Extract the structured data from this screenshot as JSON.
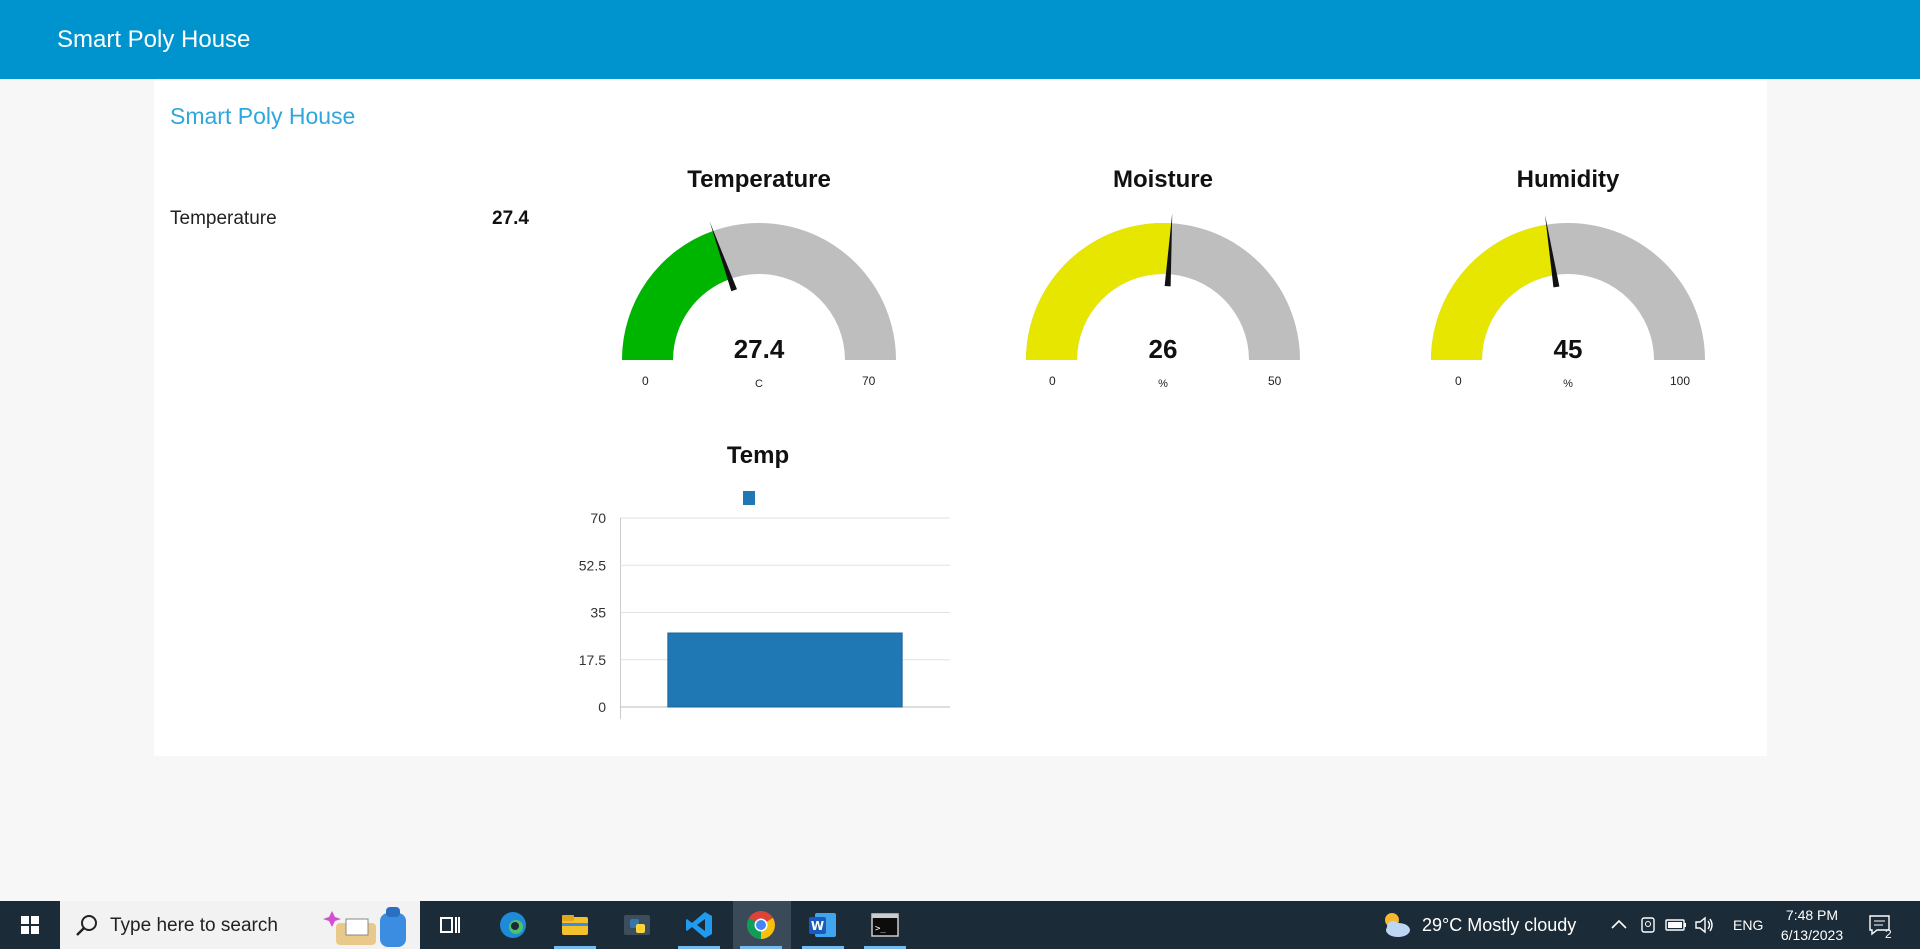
{
  "app": {
    "title": "Smart Poly House"
  },
  "card": {
    "title": "Smart Poly House"
  },
  "text_widget": {
    "label": "Temperature",
    "value": "27.4"
  },
  "gauges": [
    {
      "title": "Temperature",
      "value": "27.4",
      "unit": "C",
      "min": "0",
      "max": "70",
      "fraction": 0.391,
      "fill_color": "#00b500",
      "track_color": "#bebebe"
    },
    {
      "title": "Moisture",
      "value": "26",
      "unit": "%",
      "min": "0",
      "max": "50",
      "fraction": 0.52,
      "fill_color": "#e6e600",
      "track_color": "#bebebe"
    },
    {
      "title": "Humidity",
      "value": "45",
      "unit": "%",
      "min": "0",
      "max": "100",
      "fraction": 0.45,
      "fill_color": "#e6e600",
      "track_color": "#bebebe"
    }
  ],
  "chart_title": "Temp",
  "chart_data": {
    "type": "bar",
    "categories": [
      ""
    ],
    "values": [
      27.4
    ],
    "ylim": [
      0,
      70
    ],
    "yticks": [
      "0",
      "17.5",
      "35",
      "52.5",
      "70"
    ],
    "ytick_values": [
      0,
      17.5,
      35,
      52.5,
      70
    ],
    "grid": true,
    "legend": "top-center",
    "bar_color": "#1f77b4"
  },
  "taskbar": {
    "search_placeholder": "Type here to search",
    "weather": "29°C  Mostly cloudy",
    "language": "ENG",
    "time": "7:48 PM",
    "date": "6/13/2023",
    "notification_count": "2",
    "icons": [
      "windows-start",
      "search",
      "task-view",
      "edge",
      "file-explorer",
      "python-idle",
      "vscode",
      "chrome",
      "word",
      "terminal"
    ]
  },
  "colors": {
    "header": "#0094ce",
    "card_title": "#2fa6dc",
    "taskbar": "#1c2b38"
  }
}
